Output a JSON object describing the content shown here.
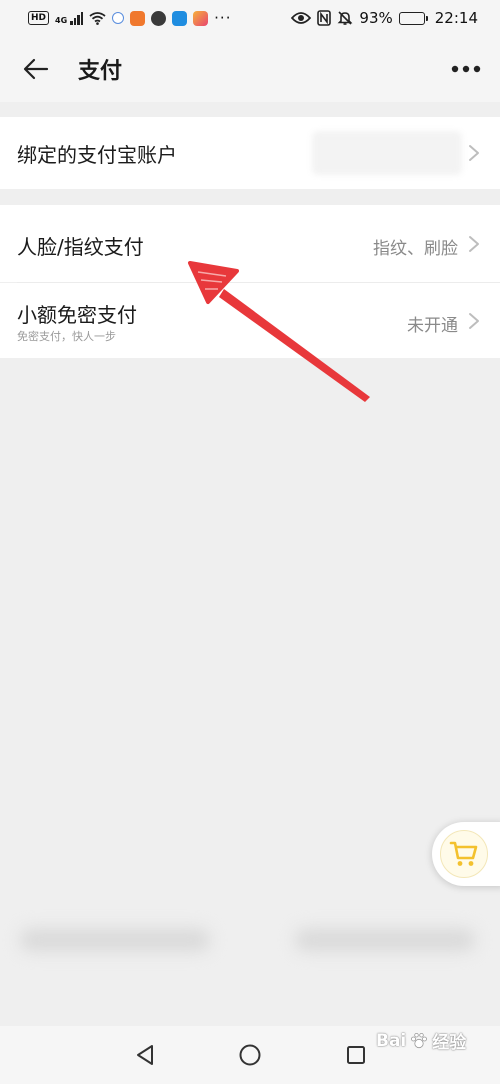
{
  "status_bar": {
    "left_icons": [
      "hd-icon",
      "signal-icon",
      "wifi-icon",
      "music-app-icon",
      "orange-app-icon",
      "compass-app-icon",
      "cloud-app-icon",
      "gallery-app-icon"
    ],
    "network_label": "4G",
    "hd_label": "HD",
    "more_notifications": "···",
    "right_icons": [
      "eye-icon",
      "nfc-icon",
      "mute-bell-icon"
    ],
    "battery_percent": "93%",
    "time": "22:14"
  },
  "header": {
    "title": "支付"
  },
  "settings": {
    "bound_account": {
      "label": "绑定的支付宝账户"
    },
    "biometric": {
      "label": "人脸/指纹支付",
      "value": "指纹、刷脸"
    },
    "small_amount": {
      "label": "小额免密支付",
      "subtitle": "免密支付，快人一步",
      "value": "未开通"
    }
  },
  "annotation": {
    "arrow_color": "#e8383b"
  },
  "floating": {
    "cart_icon": "shopping-cart-icon",
    "cart_color": "#f3c12e"
  },
  "watermark": {
    "brand": "Bai",
    "brand_suffix": "经验"
  },
  "colors": {
    "page_bg": "#efefef",
    "card_bg": "#ffffff",
    "chevron": "#bdbdbd",
    "value_text": "#8a8a8a"
  }
}
